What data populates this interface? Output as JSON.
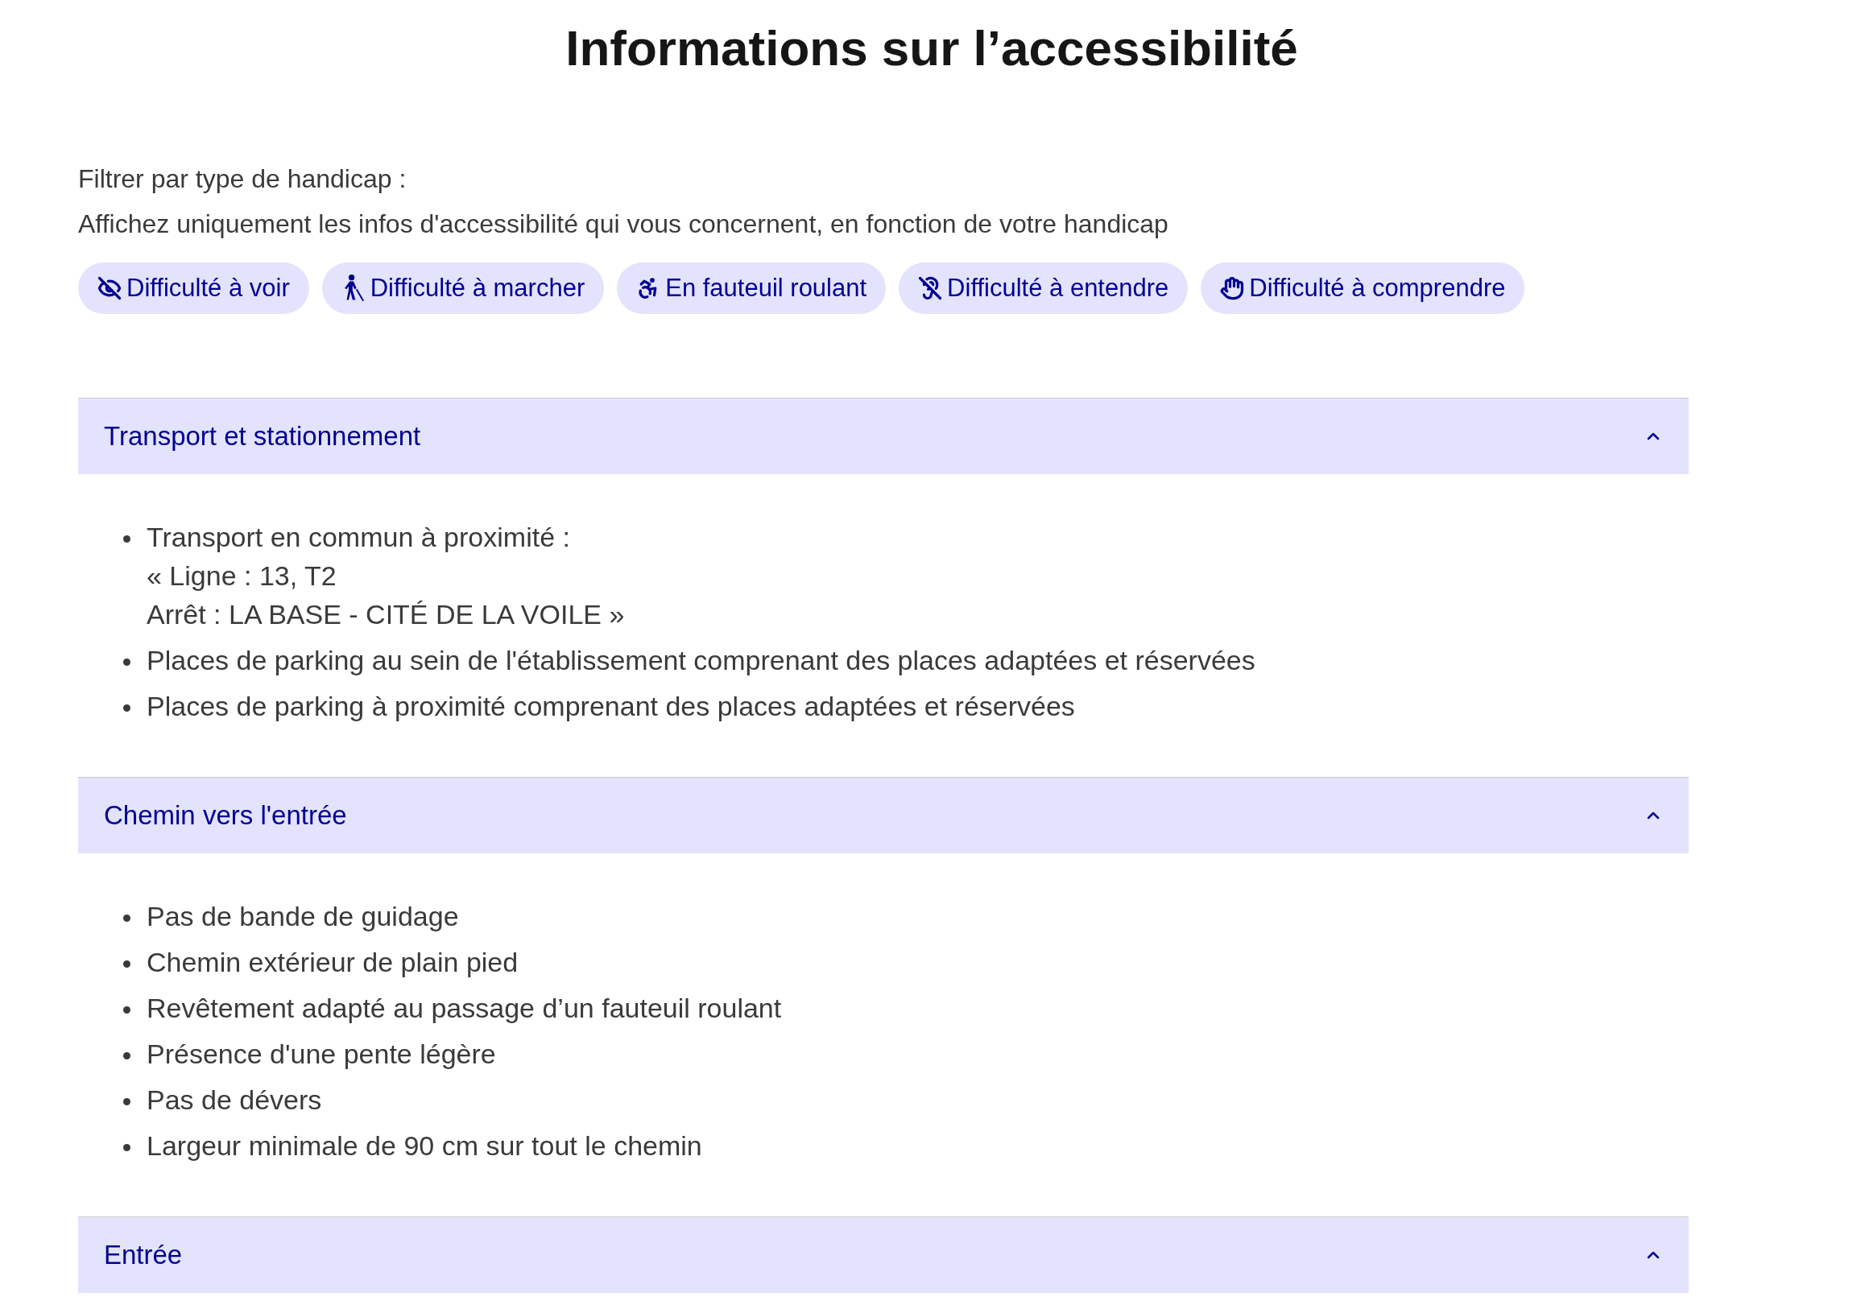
{
  "title": "Informations sur l’accessibilité",
  "filter": {
    "label": "Filtrer par type de handicap :",
    "description": "Affichez uniquement les infos d'accessibilité qui vous concernent, en fonction de votre handicap",
    "buttons": [
      {
        "kind": "vision",
        "label": "Difficulté à voir"
      },
      {
        "kind": "walking",
        "label": "Difficulté à marcher"
      },
      {
        "kind": "wheelchair",
        "label": "En fauteuil roulant"
      },
      {
        "kind": "hearing",
        "label": "Difficulté à entendre"
      },
      {
        "kind": "understanding",
        "label": "Difficulté à comprendre"
      }
    ]
  },
  "sections": [
    {
      "title": "Transport et stationnement",
      "expanded": true,
      "items": [
        {
          "lines": [
            "Transport en commun à proximité :",
            "« Ligne : 13, T2",
            "Arrêt : LA BASE - CITÉ DE LA VOILE »"
          ]
        },
        {
          "lines": [
            "Places de parking au sein de l'établissement comprenant des places adaptées et réservées"
          ]
        },
        {
          "lines": [
            "Places de parking à proximité comprenant des places adaptées et réservées"
          ]
        }
      ]
    },
    {
      "title": "Chemin vers l'entrée",
      "expanded": true,
      "items": [
        {
          "lines": [
            "Pas de bande de guidage"
          ]
        },
        {
          "lines": [
            "Chemin extérieur de plain pied"
          ]
        },
        {
          "lines": [
            "Revêtement adapté au passage d’un fauteuil roulant"
          ]
        },
        {
          "lines": [
            "Présence d'une pente légère"
          ]
        },
        {
          "lines": [
            "Pas de dévers"
          ]
        },
        {
          "lines": [
            "Largeur minimale de 90 cm sur tout le chemin"
          ]
        }
      ]
    },
    {
      "title": "Entrée",
      "expanded": true
    }
  ]
}
